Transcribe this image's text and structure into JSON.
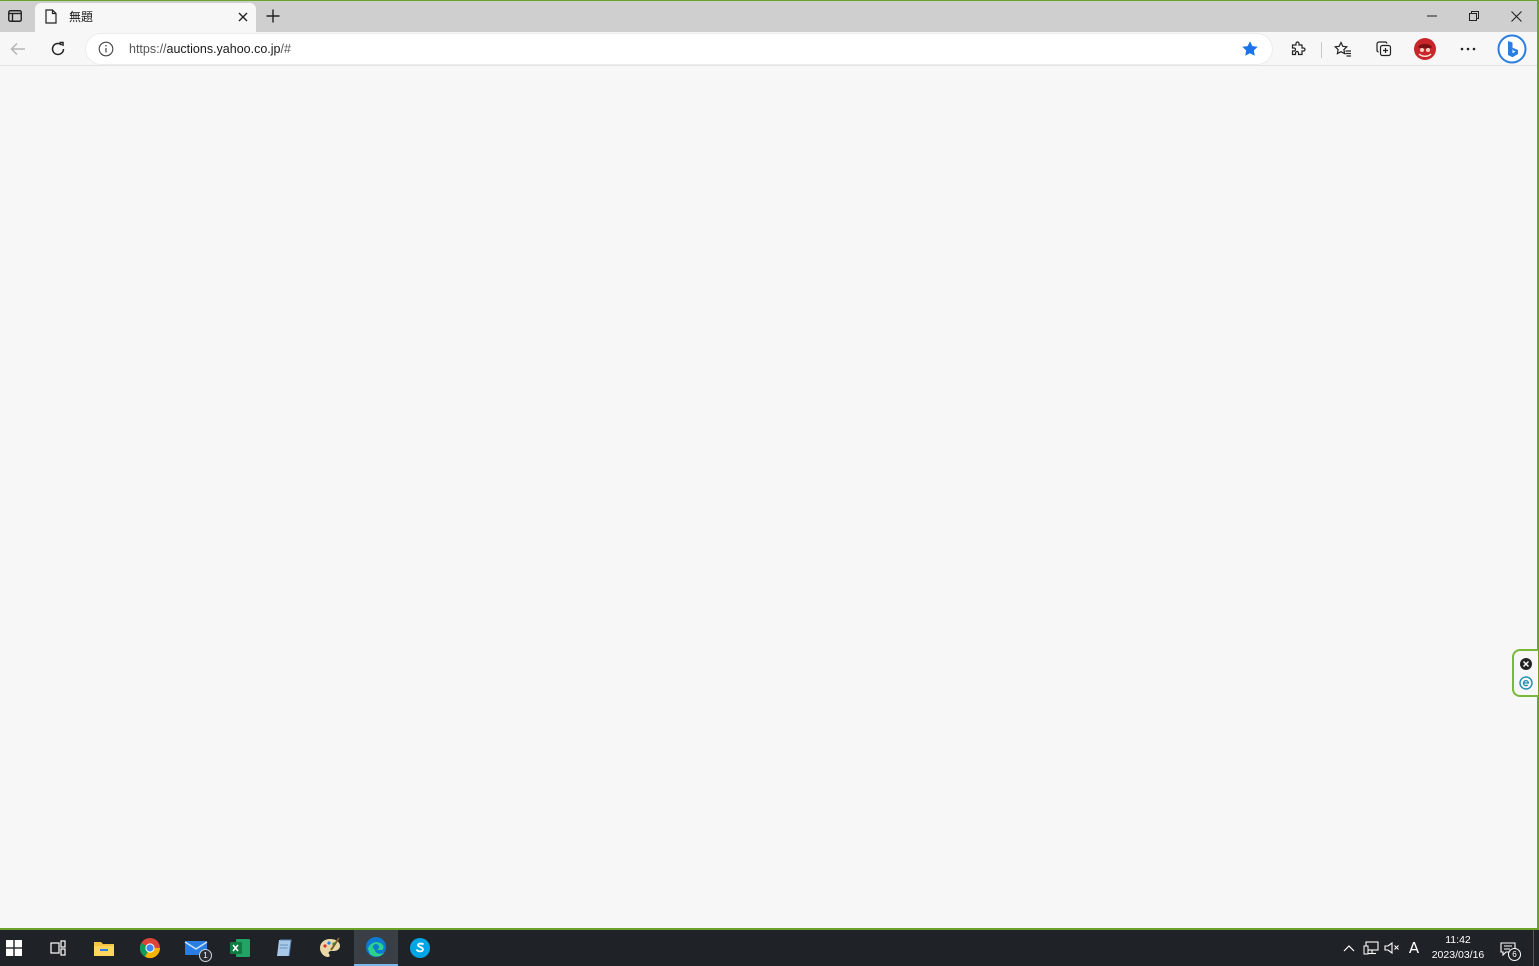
{
  "browser": {
    "tab": {
      "title": "無題"
    },
    "address_bar": {
      "url_scheme": "https://",
      "url_host": "auctions.yahoo.co.jp",
      "url_path": "/#"
    },
    "icons": {
      "tab_actions": "tab-actions-icon",
      "page": "page-icon",
      "close_tab": "close-icon",
      "new_tab": "plus-icon",
      "minimize": "minimize-icon",
      "restore": "restore-icon",
      "close_window": "close-icon",
      "back": "back-arrow-icon",
      "refresh": "refresh-icon",
      "info": "info-icon",
      "favorite": "star-filled-icon",
      "extensions": "puzzle-icon",
      "favorites": "favorites-icon",
      "collections": "collections-icon",
      "profile": "avatar-icon",
      "menu": "ellipsis-icon",
      "bing": "bing-icon"
    },
    "colors": {
      "star": "#1a73e8",
      "accent_green": "#7ab83a"
    }
  },
  "taskbar": {
    "apps": [
      "start",
      "task-view",
      "file-explorer",
      "chrome",
      "mail",
      "excel",
      "notepad",
      "paint",
      "edge",
      "skype"
    ],
    "mail_badge": "1",
    "ime": "A",
    "clock_time": "11:42",
    "clock_date": "2023/03/16",
    "notification_count": "6"
  }
}
